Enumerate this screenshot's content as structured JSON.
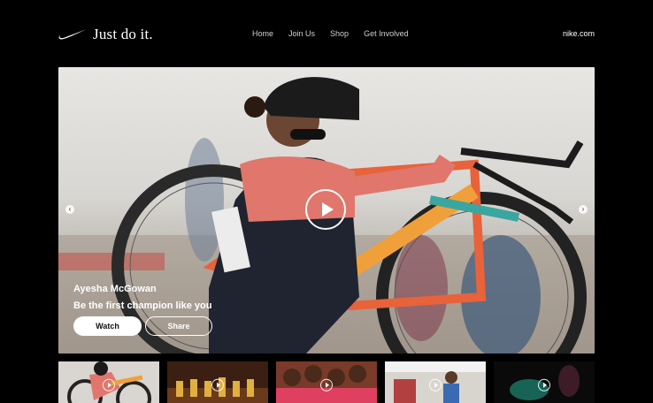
{
  "header": {
    "tagline": "Just do it.",
    "nav": [
      "Home",
      "Join Us",
      "Shop",
      "Get Involved"
    ],
    "site": "nike.com"
  },
  "hero": {
    "athlete": "Ayesha McGowan",
    "slogan": "Be the first champion like you",
    "watch_label": "Watch",
    "share_label": "Share",
    "prev_arrow": "‹",
    "next_arrow": "›"
  },
  "thumbnails": [
    {
      "name": "cyclist-thumb"
    },
    {
      "name": "dancers-thumb"
    },
    {
      "name": "team-thumb"
    },
    {
      "name": "gym-thumb"
    },
    {
      "name": "dark-thumb"
    }
  ]
}
